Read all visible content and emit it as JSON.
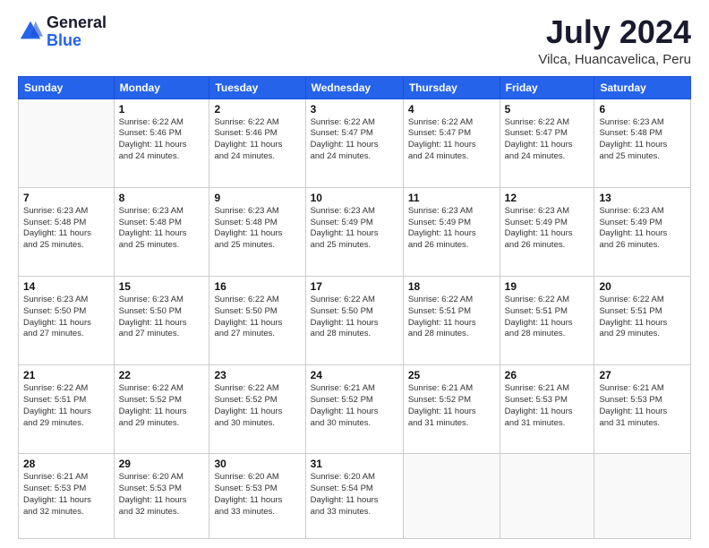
{
  "logo": {
    "general": "General",
    "blue": "Blue"
  },
  "title": "July 2024",
  "location": "Vilca, Huancavelica, Peru",
  "headers": [
    "Sunday",
    "Monday",
    "Tuesday",
    "Wednesday",
    "Thursday",
    "Friday",
    "Saturday"
  ],
  "weeks": [
    [
      {
        "day": "",
        "detail": ""
      },
      {
        "day": "1",
        "detail": "Sunrise: 6:22 AM\nSunset: 5:46 PM\nDaylight: 11 hours\nand 24 minutes."
      },
      {
        "day": "2",
        "detail": "Sunrise: 6:22 AM\nSunset: 5:46 PM\nDaylight: 11 hours\nand 24 minutes."
      },
      {
        "day": "3",
        "detail": "Sunrise: 6:22 AM\nSunset: 5:47 PM\nDaylight: 11 hours\nand 24 minutes."
      },
      {
        "day": "4",
        "detail": "Sunrise: 6:22 AM\nSunset: 5:47 PM\nDaylight: 11 hours\nand 24 minutes."
      },
      {
        "day": "5",
        "detail": "Sunrise: 6:22 AM\nSunset: 5:47 PM\nDaylight: 11 hours\nand 24 minutes."
      },
      {
        "day": "6",
        "detail": "Sunrise: 6:23 AM\nSunset: 5:48 PM\nDaylight: 11 hours\nand 25 minutes."
      }
    ],
    [
      {
        "day": "7",
        "detail": "Sunrise: 6:23 AM\nSunset: 5:48 PM\nDaylight: 11 hours\nand 25 minutes."
      },
      {
        "day": "8",
        "detail": "Sunrise: 6:23 AM\nSunset: 5:48 PM\nDaylight: 11 hours\nand 25 minutes."
      },
      {
        "day": "9",
        "detail": "Sunrise: 6:23 AM\nSunset: 5:48 PM\nDaylight: 11 hours\nand 25 minutes."
      },
      {
        "day": "10",
        "detail": "Sunrise: 6:23 AM\nSunset: 5:49 PM\nDaylight: 11 hours\nand 25 minutes."
      },
      {
        "day": "11",
        "detail": "Sunrise: 6:23 AM\nSunset: 5:49 PM\nDaylight: 11 hours\nand 26 minutes."
      },
      {
        "day": "12",
        "detail": "Sunrise: 6:23 AM\nSunset: 5:49 PM\nDaylight: 11 hours\nand 26 minutes."
      },
      {
        "day": "13",
        "detail": "Sunrise: 6:23 AM\nSunset: 5:49 PM\nDaylight: 11 hours\nand 26 minutes."
      }
    ],
    [
      {
        "day": "14",
        "detail": "Sunrise: 6:23 AM\nSunset: 5:50 PM\nDaylight: 11 hours\nand 27 minutes."
      },
      {
        "day": "15",
        "detail": "Sunrise: 6:23 AM\nSunset: 5:50 PM\nDaylight: 11 hours\nand 27 minutes."
      },
      {
        "day": "16",
        "detail": "Sunrise: 6:22 AM\nSunset: 5:50 PM\nDaylight: 11 hours\nand 27 minutes."
      },
      {
        "day": "17",
        "detail": "Sunrise: 6:22 AM\nSunset: 5:50 PM\nDaylight: 11 hours\nand 28 minutes."
      },
      {
        "day": "18",
        "detail": "Sunrise: 6:22 AM\nSunset: 5:51 PM\nDaylight: 11 hours\nand 28 minutes."
      },
      {
        "day": "19",
        "detail": "Sunrise: 6:22 AM\nSunset: 5:51 PM\nDaylight: 11 hours\nand 28 minutes."
      },
      {
        "day": "20",
        "detail": "Sunrise: 6:22 AM\nSunset: 5:51 PM\nDaylight: 11 hours\nand 29 minutes."
      }
    ],
    [
      {
        "day": "21",
        "detail": "Sunrise: 6:22 AM\nSunset: 5:51 PM\nDaylight: 11 hours\nand 29 minutes."
      },
      {
        "day": "22",
        "detail": "Sunrise: 6:22 AM\nSunset: 5:52 PM\nDaylight: 11 hours\nand 29 minutes."
      },
      {
        "day": "23",
        "detail": "Sunrise: 6:22 AM\nSunset: 5:52 PM\nDaylight: 11 hours\nand 30 minutes."
      },
      {
        "day": "24",
        "detail": "Sunrise: 6:21 AM\nSunset: 5:52 PM\nDaylight: 11 hours\nand 30 minutes."
      },
      {
        "day": "25",
        "detail": "Sunrise: 6:21 AM\nSunset: 5:52 PM\nDaylight: 11 hours\nand 31 minutes."
      },
      {
        "day": "26",
        "detail": "Sunrise: 6:21 AM\nSunset: 5:53 PM\nDaylight: 11 hours\nand 31 minutes."
      },
      {
        "day": "27",
        "detail": "Sunrise: 6:21 AM\nSunset: 5:53 PM\nDaylight: 11 hours\nand 31 minutes."
      }
    ],
    [
      {
        "day": "28",
        "detail": "Sunrise: 6:21 AM\nSunset: 5:53 PM\nDaylight: 11 hours\nand 32 minutes."
      },
      {
        "day": "29",
        "detail": "Sunrise: 6:20 AM\nSunset: 5:53 PM\nDaylight: 11 hours\nand 32 minutes."
      },
      {
        "day": "30",
        "detail": "Sunrise: 6:20 AM\nSunset: 5:53 PM\nDaylight: 11 hours\nand 33 minutes."
      },
      {
        "day": "31",
        "detail": "Sunrise: 6:20 AM\nSunset: 5:54 PM\nDaylight: 11 hours\nand 33 minutes."
      },
      {
        "day": "",
        "detail": ""
      },
      {
        "day": "",
        "detail": ""
      },
      {
        "day": "",
        "detail": ""
      }
    ]
  ]
}
